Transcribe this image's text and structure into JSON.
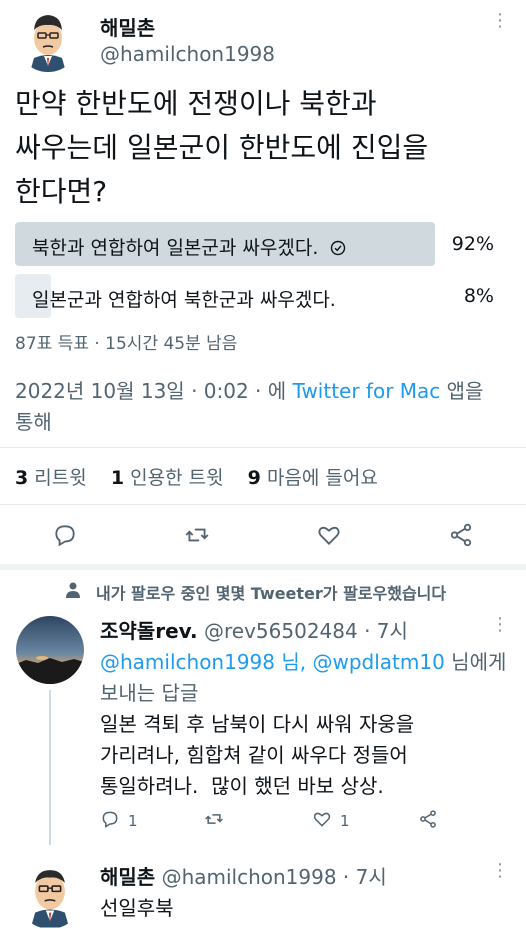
{
  "author": {
    "name": "해밀촌",
    "handle": "@hamilchon1998"
  },
  "tweet": {
    "text_line1": "만약 한반도에 전쟁이나 북한과",
    "text_line2": "싸우는데 일본군이 한반도에 진입을",
    "text_line3": "한다면?"
  },
  "poll": {
    "options": [
      {
        "label": "북한과 연합하여 일본군과 싸우겠다.",
        "percent": "92%",
        "fraction": 0.92,
        "winner": true,
        "check_icon": "check-circle-icon"
      },
      {
        "label": "일본군과 연합하여 북한군과 싸우겠다.",
        "percent": "8%",
        "fraction": 0.08,
        "winner": false
      }
    ],
    "meta": "87표 득표 · 15시간 45분 남음"
  },
  "timestamp": {
    "text": "2022년 10월 13일 · 0:02 · 에",
    "source": "Twitter for Mac",
    "suffix_line1": " 앱을",
    "suffix_line2": "통해"
  },
  "stats": {
    "retweets_count": "3",
    "retweets_label": "리트윗",
    "quotes_count": "1",
    "quotes_label": "인용한 트윗",
    "likes_count": "9",
    "likes_label": "마음에 들어요"
  },
  "actions": [
    "reply-icon",
    "retweet-icon",
    "like-icon",
    "share-icon"
  ],
  "social_context": {
    "icon": "person-icon",
    "text": "내가 팔로우 중인 몇몇 Tweeter가 팔로우했습니다"
  },
  "reply1": {
    "name": "조약돌rev.",
    "handle": "@rev56502484",
    "time": " · 7시",
    "replying_mention1": "@hamilchon1998 님,",
    "replying_mention2": "@wpdlatm10",
    "replying_suffix": " 님에게",
    "replying_line2": "보내는 답글",
    "text_line1": "일본 격퇴 후 남북이 다시 싸워 자웅을",
    "text_line2": "가리려나, 힘합쳐 같이 싸우다 정들어",
    "text_line3": "통일하려나.  많이 했던 바보 상상.",
    "reply_count": "1",
    "like_count": "1"
  },
  "reply2": {
    "name": "해밀촌",
    "handle": "@hamilchon1998",
    "time": " · 7시",
    "text": "선일후북"
  },
  "colors": {
    "accent": "#1d9bf0",
    "poll_winner": "#cfd9de",
    "poll_loser": "#e6ecf0",
    "muted": "#536471"
  }
}
